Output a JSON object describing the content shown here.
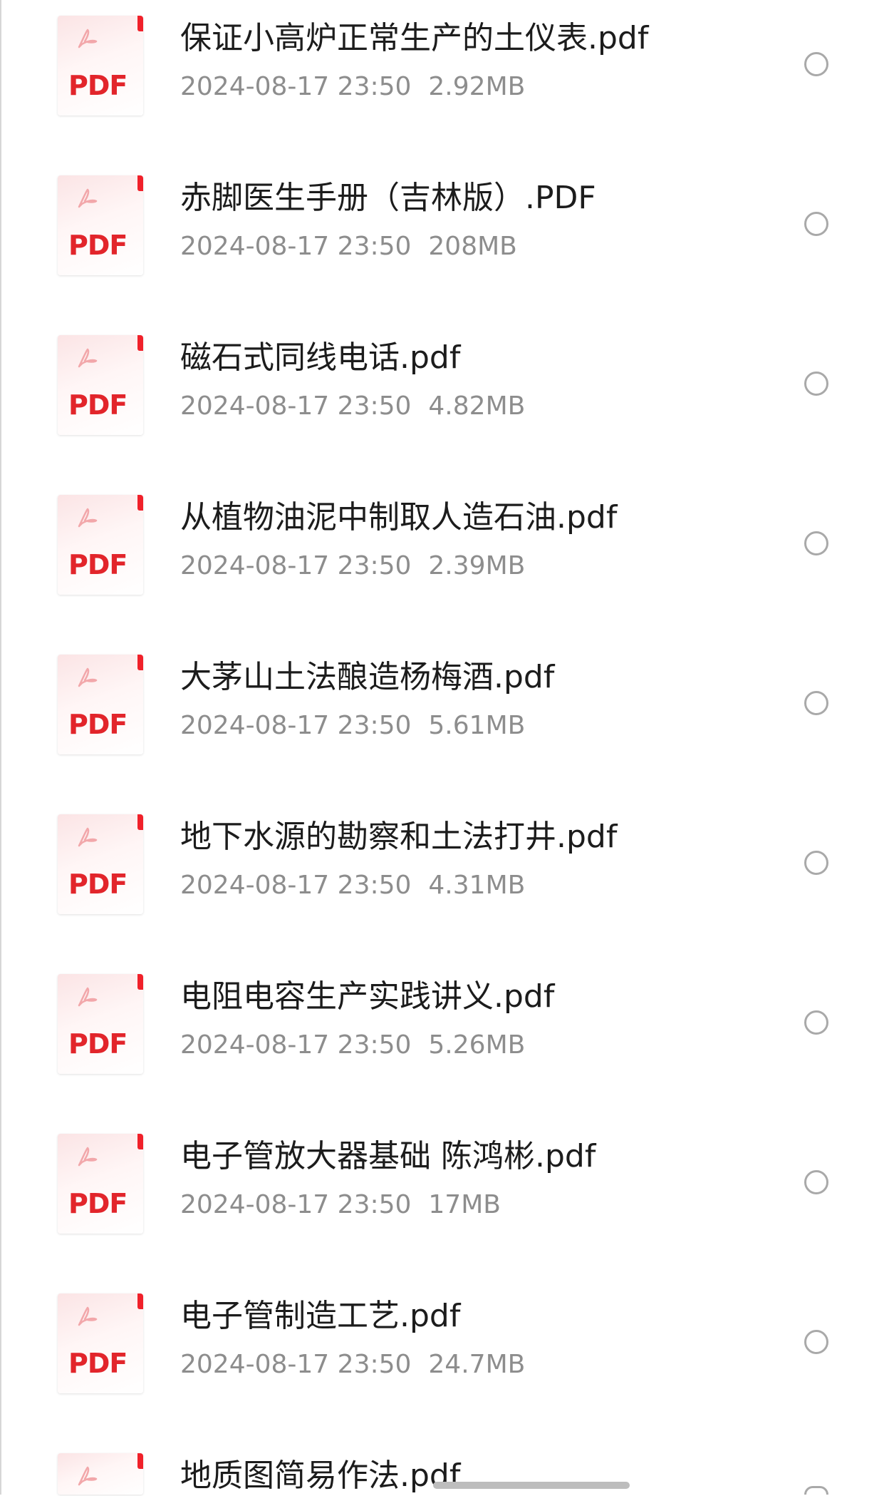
{
  "files": [
    {
      "name": "保证小高炉正常生产的土仪表.pdf",
      "date": "2024-08-17 23:50",
      "size": "2.92MB",
      "icon_label": "PDF"
    },
    {
      "name": "赤脚医生手册（吉林版）.PDF",
      "date": "2024-08-17 23:50",
      "size": "208MB",
      "icon_label": "PDF"
    },
    {
      "name": "磁石式同线电话.pdf",
      "date": "2024-08-17 23:50",
      "size": "4.82MB",
      "icon_label": "PDF"
    },
    {
      "name": "从植物油泥中制取人造石油.pdf",
      "date": "2024-08-17 23:50",
      "size": "2.39MB",
      "icon_label": "PDF"
    },
    {
      "name": "大茅山土法酿造杨梅酒.pdf",
      "date": "2024-08-17 23:50",
      "size": "5.61MB",
      "icon_label": "PDF"
    },
    {
      "name": "地下水源的勘察和土法打井.pdf",
      "date": "2024-08-17 23:50",
      "size": "4.31MB",
      "icon_label": "PDF"
    },
    {
      "name": "电阻电容生产实践讲义.pdf",
      "date": "2024-08-17 23:50",
      "size": "5.26MB",
      "icon_label": "PDF"
    },
    {
      "name": "电子管放大器基础 陈鸿彬.pdf",
      "date": "2024-08-17 23:50",
      "size": "17MB",
      "icon_label": "PDF"
    },
    {
      "name": "电子管制造工艺.pdf",
      "date": "2024-08-17 23:50",
      "size": "24.7MB",
      "icon_label": "PDF"
    },
    {
      "name": "地质图简易作法.pdf",
      "date": "",
      "size": "",
      "icon_label": "PDF"
    }
  ],
  "colors": {
    "pdf_red": "#e2252b",
    "title_text": "#1c1c1c",
    "meta_text": "#8d8d8d",
    "radio_border": "#a9a9a9"
  },
  "icons": {
    "file_type": "pdf-file-icon",
    "select": "radio-circle-icon"
  }
}
